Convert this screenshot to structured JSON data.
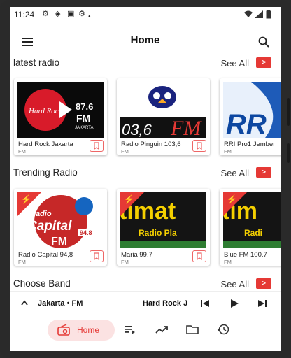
{
  "status": {
    "time": "11:24"
  },
  "header": {
    "title": "Home"
  },
  "sections": {
    "latest": {
      "title": "latest radio",
      "see_all": "See All"
    },
    "trending": {
      "title": "Trending Radio",
      "see_all": "See All"
    },
    "band": {
      "title": "Choose Band",
      "see_all": "See All"
    }
  },
  "latest_cards": [
    {
      "name": "Hard Rock Jakarta",
      "sub": "FM",
      "logo_brand": "Hard Rock",
      "logo_freq": "87.6",
      "logo_fm": "FM",
      "logo_city": "JAKARTA"
    },
    {
      "name": "Radio Pinguin 103,6",
      "sub": "FM",
      "logo_text": "03,6",
      "logo_fm": "FM"
    },
    {
      "name": "RRI Pro1 Jember",
      "sub": "FM",
      "logo_text": "RR"
    }
  ],
  "trending_cards": [
    {
      "name": "Radio Capital  94,8",
      "sub": "FM",
      "logo_top": "Radio",
      "logo_mid": "Capital",
      "logo_bottom": "FM",
      "logo_num": "94.8"
    },
    {
      "name": "Maria  99.7",
      "sub": "FM",
      "logo_top": "timat",
      "logo_bottom": "Radio Pla"
    },
    {
      "name": "Blue FM 100.7",
      "sub": "FM",
      "logo_top": "tim",
      "logo_bottom": "Radi"
    }
  ],
  "player": {
    "now_playing": "Jakarta • FM",
    "station": "Hard Rock J"
  },
  "nav": {
    "home_label": "Home"
  },
  "colors": {
    "accent": "#e53935",
    "pill": "#fbe2e2"
  }
}
